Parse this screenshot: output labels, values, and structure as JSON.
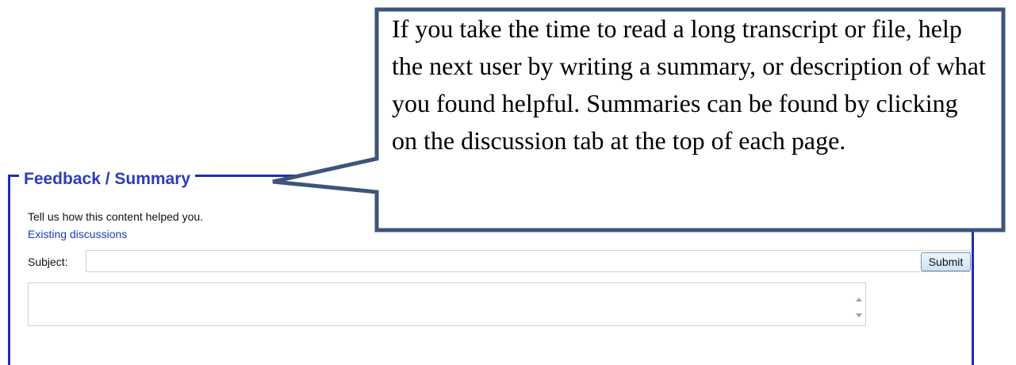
{
  "callout": {
    "text": "If you take the time to read a long transcript or file, help the next user by writing a summary, or description of what you found helpful.  Summaries can be found by clicking on the discussion tab at the top of each page."
  },
  "feedback": {
    "title": "Feedback / Summary",
    "description": "Tell us how this content helped you.",
    "existing_link": "Existing discussions",
    "subject_label": "Subject:",
    "subject_value": "",
    "submit_label": "Submit",
    "body_value": ""
  },
  "colors": {
    "frame": "#1c2fb5",
    "title": "#2b3db8",
    "link": "#1a3fc0",
    "callout_border": "#3c5578"
  },
  "icons": [
    "scroll-up-arrow-icon",
    "scroll-down-arrow-icon"
  ]
}
